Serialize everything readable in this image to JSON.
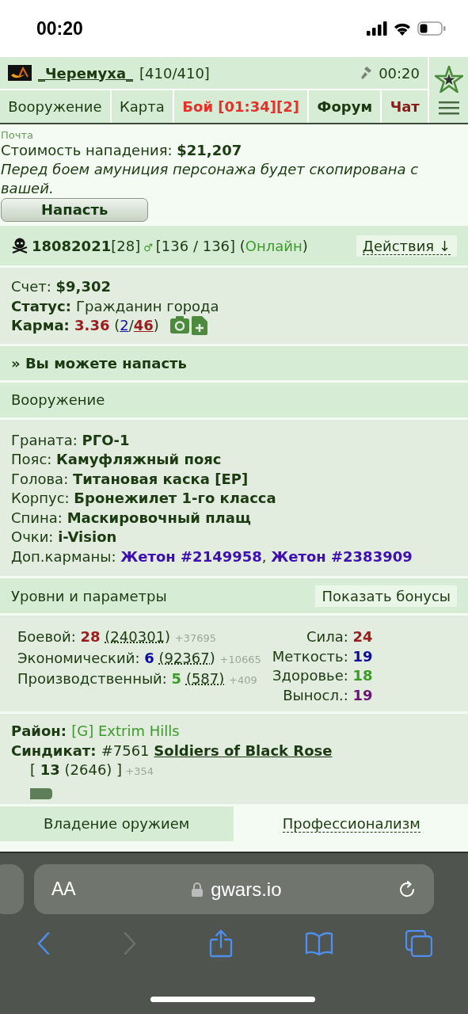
{
  "status_bar": {
    "time": "00:20"
  },
  "header": {
    "user": "_Черемуха_",
    "hp": "[410/410]",
    "time": "00:20"
  },
  "nav": [
    {
      "label": "Вооружение",
      "kind": "normal"
    },
    {
      "label": "Карта",
      "kind": "normal"
    },
    {
      "label": "Бой [01:34][2]",
      "kind": "alert"
    },
    {
      "label": "Форум",
      "kind": "strong"
    },
    {
      "label": "Чат",
      "kind": "hot"
    }
  ],
  "mail": "Почта",
  "attack": {
    "cost": [
      {
        "text": "Стоимость нападения: ",
        "kind": "plain"
      },
      {
        "text": "$21,207",
        "kind": "bold"
      }
    ],
    "note": "Перед боем амуниция персонажа будет скопирована с вашей.",
    "button": "Напасть"
  },
  "player": {
    "line": [
      {
        "text": "18082021",
        "kind": "bold"
      },
      {
        "text": "[28]",
        "kind": "plain"
      },
      {
        "text": "♂",
        "kind": "gender"
      },
      {
        "text": "[136 / 136] (",
        "kind": "plain"
      },
      {
        "text": "Онлайн",
        "kind": "green"
      },
      {
        "text": ")",
        "kind": "plain"
      }
    ],
    "actions": "Действия ↓"
  },
  "account": {
    "lines": [
      [
        {
          "text": "Счет: ",
          "kind": "plain"
        },
        {
          "text": "$9,302",
          "kind": "bold"
        }
      ],
      [
        {
          "text": "Статус: ",
          "kind": "bold"
        },
        {
          "text": "Гражданин города",
          "kind": "plain"
        }
      ],
      [
        {
          "text": "Карма: ",
          "kind": "bold"
        },
        {
          "text": "3.36",
          "kind": "red"
        },
        {
          "text": " (",
          "kind": "plain"
        },
        {
          "text": "2",
          "kind": "link-blue"
        },
        {
          "text": "/",
          "kind": "plain"
        },
        {
          "text": "46",
          "kind": "link-red"
        },
        {
          "text": ")",
          "kind": "plain"
        }
      ]
    ]
  },
  "attack_hint": "» Вы можете напасть",
  "equipment": {
    "title": "Вооружение",
    "items": [
      {
        "label": "Граната: ",
        "value": "РГО-1"
      },
      {
        "label": "Пояс: ",
        "value": "Камуфляжный пояс"
      },
      {
        "label": "Голова: ",
        "value": "Титановая каска [ЕР]"
      },
      {
        "label": "Корпус: ",
        "value": "Бронежилет 1-го класса"
      },
      {
        "label": "Спина: ",
        "value": "Маскировочный плащ"
      },
      {
        "label": "Очки: ",
        "value": "i-Vision"
      },
      {
        "label": "Доп.карманы: ",
        "links": [
          "Жетон #2149958",
          "Жетон #2383909"
        ],
        "separator": ", "
      }
    ]
  },
  "levels": {
    "title": "Уровни и параметры",
    "button": "Показать бонусы",
    "skills": [
      {
        "label": "Боевой: ",
        "level": "28",
        "exp": "(240301)",
        "gain": "+37695",
        "color": "#9b1c1c"
      },
      {
        "label": "Экономический: ",
        "level": "6",
        "exp": "(92367)",
        "gain": "+10665",
        "color": "#0d0d99"
      },
      {
        "label": "Производственный: ",
        "level": "5",
        "exp": "(587)",
        "gain": "+409",
        "color": "#3c9a2a"
      }
    ],
    "stats": [
      {
        "label": "Сила: ",
        "value": "24",
        "color": "#9b1c1c"
      },
      {
        "label": "Меткость: ",
        "value": "19",
        "color": "#0d0d99"
      },
      {
        "label": "Здоровье: ",
        "value": "18",
        "color": "#3c9a2a"
      },
      {
        "label": "Выносл.: ",
        "value": "19",
        "color": "#6b1470"
      }
    ]
  },
  "district": [
    {
      "text": "Район: ",
      "kind": "bold"
    },
    {
      "text": "[G] Extrim Hills",
      "kind": "green"
    }
  ],
  "syndicate": [
    {
      "text": "Синдикат: ",
      "kind": "bold"
    },
    {
      "text": "#7561 ",
      "kind": "plain"
    },
    {
      "text": "Soldiers of Black Rose",
      "kind": "link-bold"
    }
  ],
  "syndicate_rank": [
    {
      "text": "[ ",
      "kind": "plain"
    },
    {
      "text": "13",
      "kind": "bold"
    },
    {
      "text": " (2646) ]",
      "kind": "plain"
    },
    {
      "text": " +354",
      "kind": "muted"
    }
  ],
  "bottom_tabs": [
    {
      "label": "Владение оружием",
      "selected": true
    },
    {
      "label": "Профессионализм",
      "selected": false
    }
  ],
  "browser": {
    "text_size": "AA",
    "url": "gwars.io",
    "back_disabled": false,
    "forward_disabled": true
  }
}
